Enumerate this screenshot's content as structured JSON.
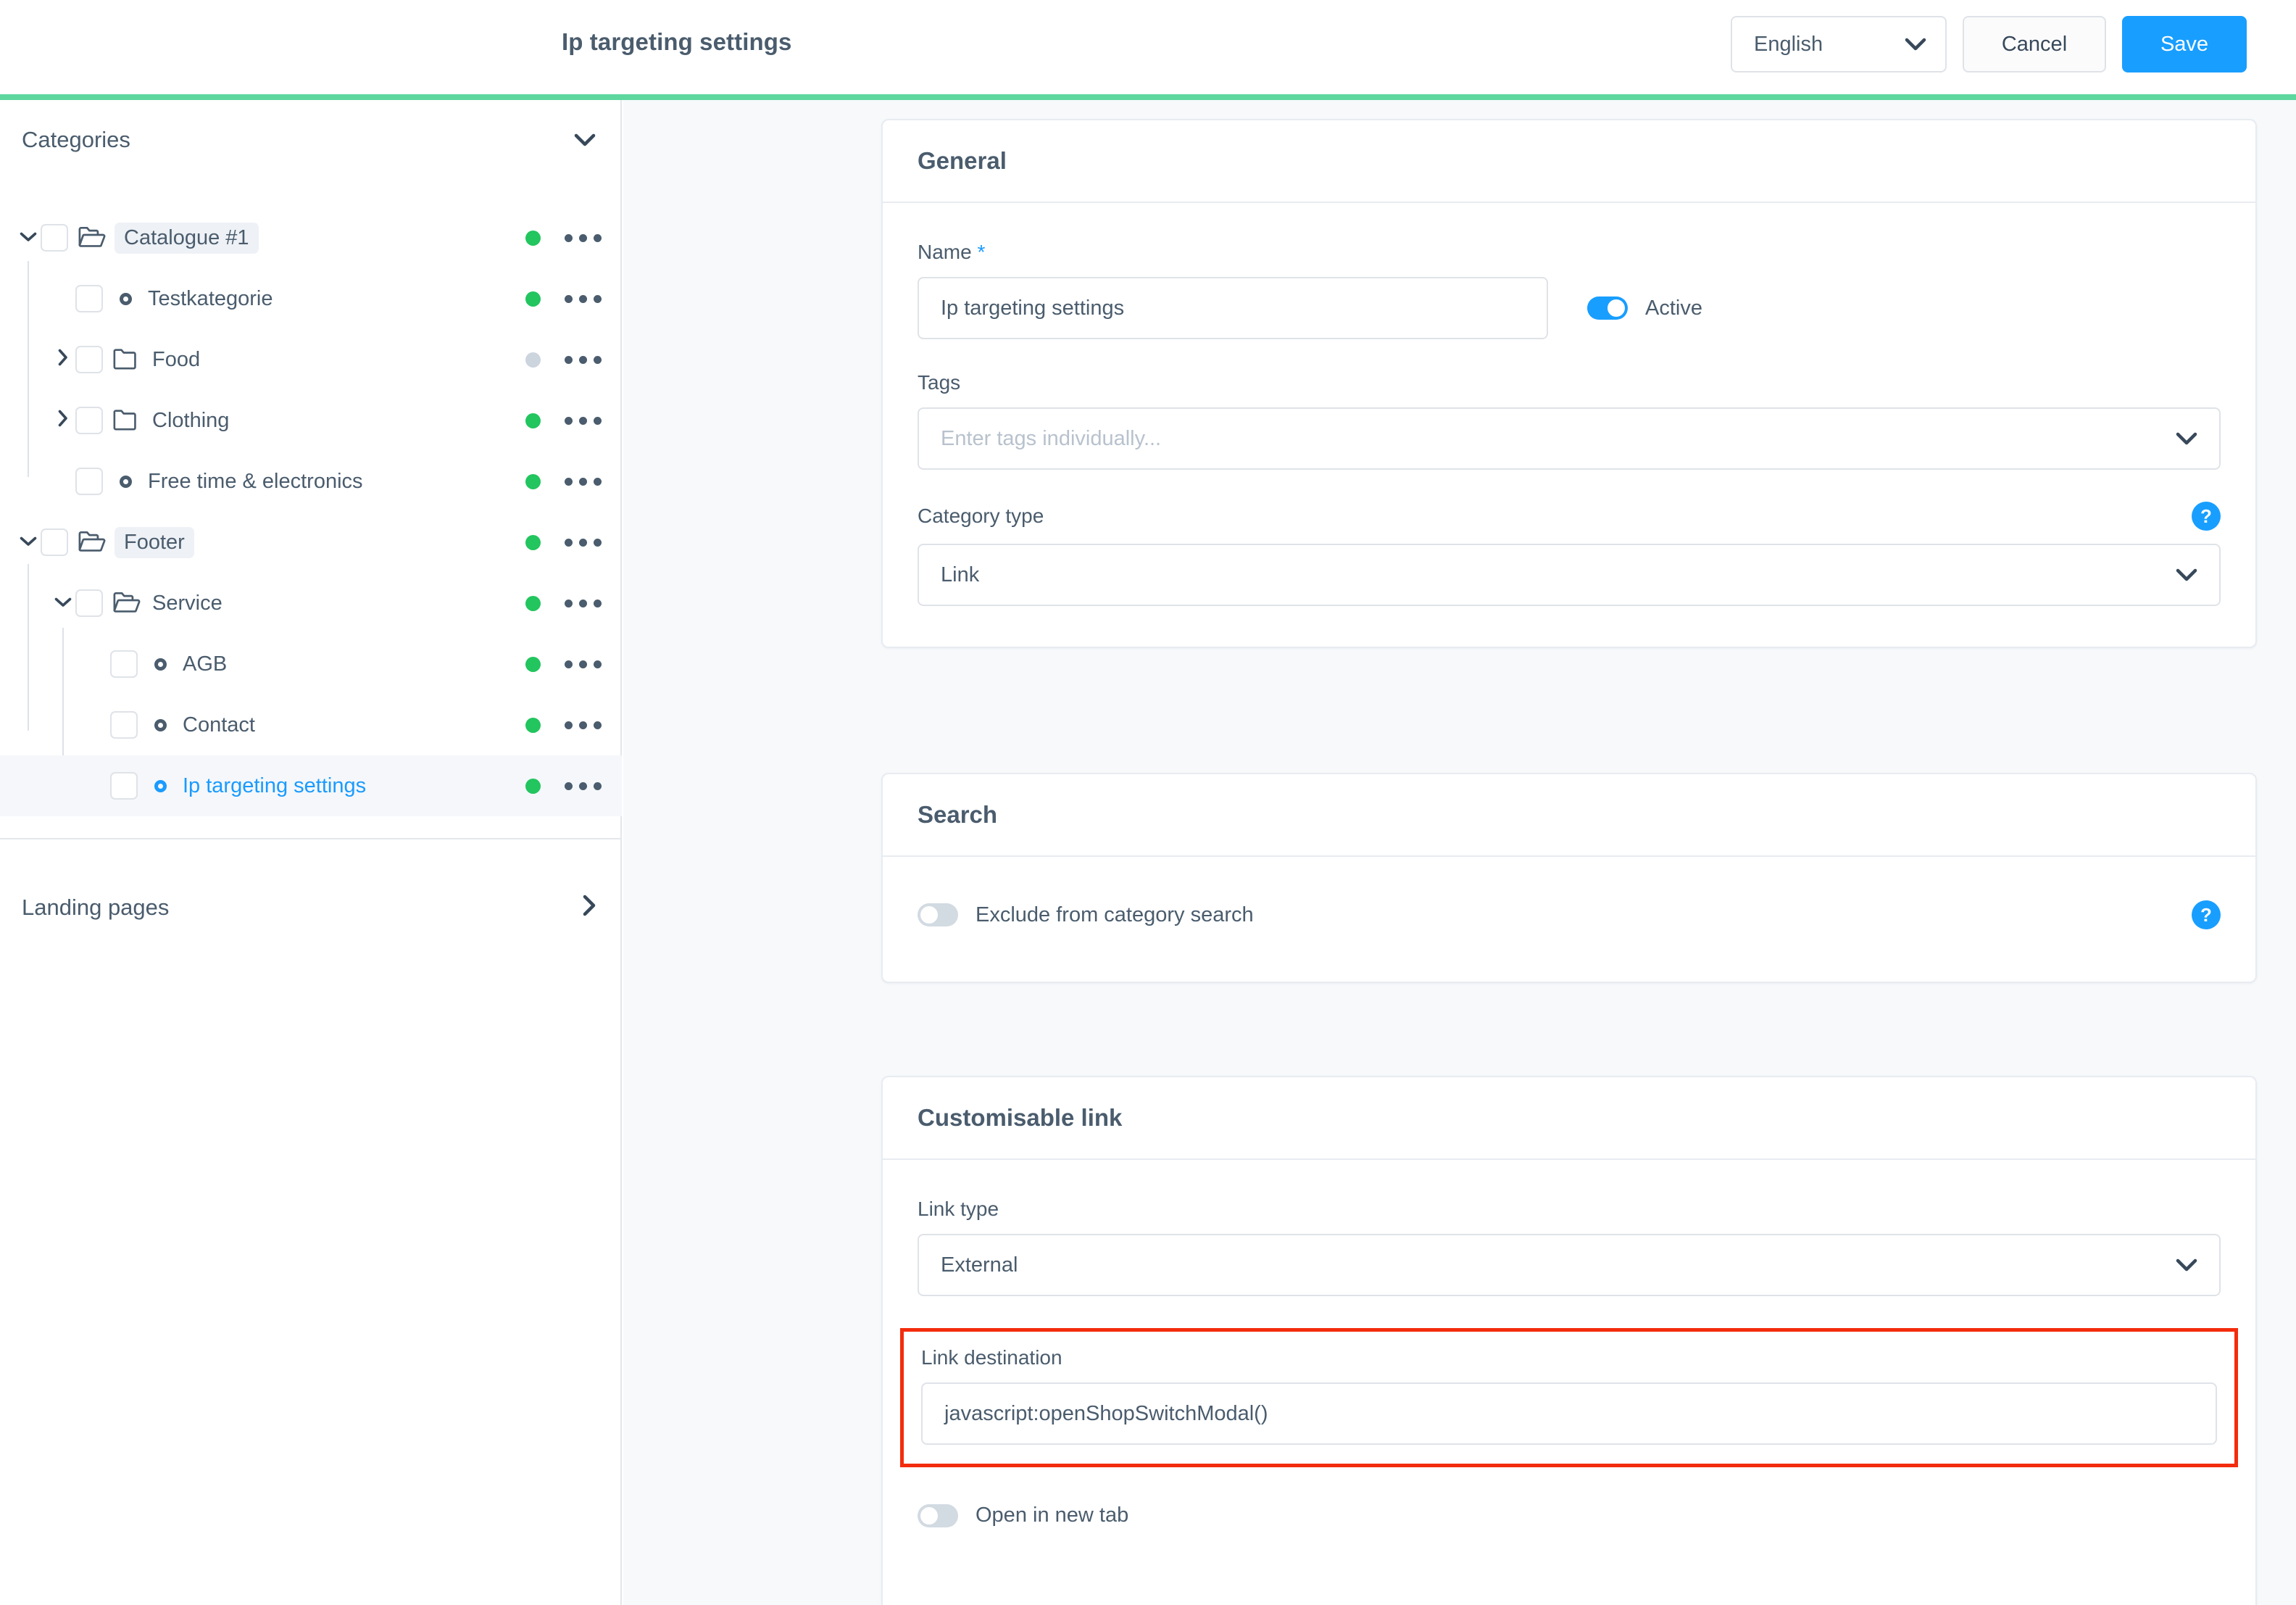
{
  "header": {
    "title": "Ip targeting settings",
    "language": "English",
    "cancel_label": "Cancel",
    "save_label": "Save",
    "accent_color": "#5ed79f"
  },
  "sidebar": {
    "categories_label": "Categories",
    "landing_pages_label": "Landing pages",
    "tree": [
      {
        "label": "Catalogue #1",
        "type": "folder-open",
        "twisty": "down",
        "depth": 0,
        "chip": true,
        "status": "active",
        "selected": false,
        "link": false
      },
      {
        "label": "Testkategorie",
        "type": "page",
        "twisty": "none",
        "depth": 1,
        "chip": false,
        "status": "active",
        "selected": false,
        "link": false
      },
      {
        "label": "Food",
        "type": "folder",
        "twisty": "right",
        "depth": 1,
        "chip": false,
        "status": "inactive",
        "selected": false,
        "link": false
      },
      {
        "label": "Clothing",
        "type": "folder",
        "twisty": "right",
        "depth": 1,
        "chip": false,
        "status": "active",
        "selected": false,
        "link": false
      },
      {
        "label": "Free time & electronics",
        "type": "page",
        "twisty": "none",
        "depth": 1,
        "chip": false,
        "status": "active",
        "selected": false,
        "link": false
      },
      {
        "label": "Footer",
        "type": "folder-open",
        "twisty": "down",
        "depth": 0,
        "chip": true,
        "status": "active",
        "selected": false,
        "link": false
      },
      {
        "label": "Service",
        "type": "folder-open",
        "twisty": "down",
        "depth": 1,
        "chip": false,
        "status": "active",
        "selected": false,
        "link": false
      },
      {
        "label": "AGB",
        "type": "page",
        "twisty": "none",
        "depth": 2,
        "chip": false,
        "status": "active",
        "selected": false,
        "link": false
      },
      {
        "label": "Contact",
        "type": "page",
        "twisty": "none",
        "depth": 2,
        "chip": false,
        "status": "active",
        "selected": false,
        "link": false
      },
      {
        "label": "Ip targeting settings",
        "type": "page",
        "twisty": "none",
        "depth": 2,
        "chip": false,
        "status": "active",
        "selected": true,
        "link": true
      }
    ],
    "status_colors": {
      "active": "#22c55e",
      "inactive": "#ccd4dd"
    }
  },
  "general": {
    "section_title": "General",
    "name_label": "Name",
    "name_required_mark": "*",
    "name_value": "Ip targeting settings",
    "active_label": "Active",
    "active_on": true,
    "tags_label": "Tags",
    "tags_placeholder": "Enter tags individually...",
    "tags_value": "",
    "category_type_label": "Category type",
    "category_type_value": "Link",
    "help_glyph": "?"
  },
  "search": {
    "section_title": "Search",
    "exclude_label": "Exclude from category search",
    "exclude_on": false,
    "help_glyph": "?"
  },
  "customisable_link": {
    "section_title": "Customisable link",
    "link_type_label": "Link type",
    "link_type_value": "External",
    "link_destination_label": "Link destination",
    "link_destination_value": "javascript:openShopSwitchModal()",
    "open_new_tab_label": "Open in new tab",
    "open_new_tab_on": false,
    "highlight_color": "#f32c0d"
  },
  "icons": {
    "chevron_down": "❯",
    "chevron_right": "❯"
  }
}
